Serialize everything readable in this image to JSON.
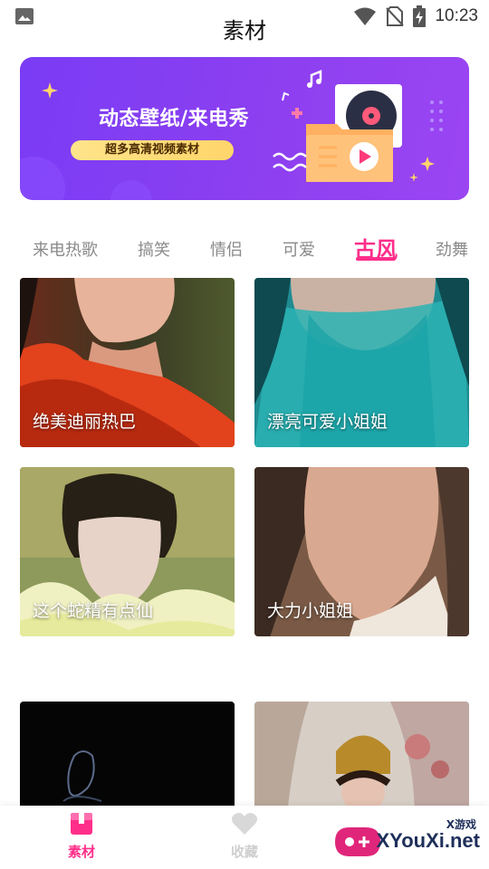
{
  "status_bar": {
    "time": "10:23",
    "icons": [
      "image-icon",
      "wifi-icon",
      "no-sim-icon",
      "battery-charging-icon"
    ]
  },
  "header": {
    "title": "素材"
  },
  "banner": {
    "title": "动态壁纸/来电秀",
    "subtitle": "超多高清视频素材",
    "colors": {
      "start": "#7a3cf5",
      "end": "#9b45f2",
      "pill": "#ffd56b"
    }
  },
  "tabs": {
    "items": [
      "来电热歌",
      "搞笑",
      "情侣",
      "可爱",
      "古风",
      "劲舞"
    ],
    "active": "古风",
    "accent": "#ff2e8a"
  },
  "grid": {
    "cards": [
      {
        "caption": "绝美迪丽热巴"
      },
      {
        "caption": "漂亮可爱小姐姐"
      },
      {
        "caption": "这个蛇精有点仙"
      },
      {
        "caption": "大力小姐姐"
      },
      {
        "caption": ""
      },
      {
        "caption": ""
      }
    ]
  },
  "bottom_nav": {
    "items": [
      {
        "label": "素材",
        "icon": "box-icon",
        "active": true
      },
      {
        "label": "收藏",
        "icon": "heart-icon",
        "active": false
      }
    ]
  },
  "watermark": {
    "small": "X游戏",
    "text": "XYouXi.net"
  }
}
